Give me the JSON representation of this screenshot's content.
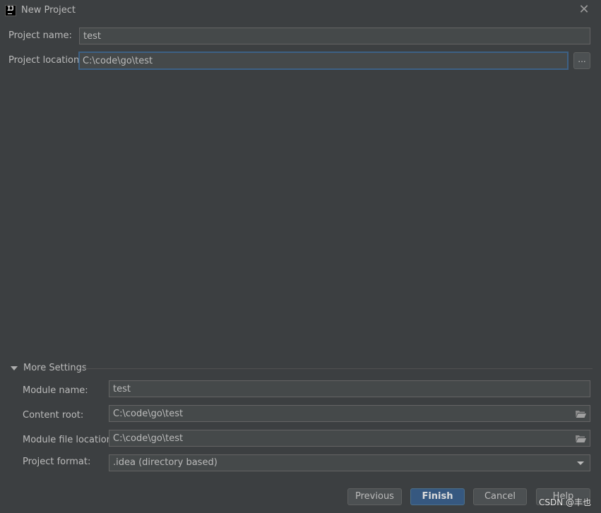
{
  "window": {
    "title": "New Project",
    "close_icon": "close-icon",
    "logo_text": "IJ"
  },
  "project": {
    "name_label": "Project name:",
    "name_value": "test",
    "location_label": "Project location:",
    "location_value": "C:\\code\\go\\test",
    "browse_label": "..."
  },
  "more_settings": {
    "title": "More Settings",
    "module_name_label": "Module name:",
    "module_name_value": "test",
    "content_root_label": "Content root:",
    "content_root_value": "C:\\code\\go\\test",
    "module_file_label": "Module file location:",
    "module_file_value": "C:\\code\\go\\test",
    "format_label": "Project format:",
    "format_value": ".idea (directory based)"
  },
  "buttons": {
    "previous": "Previous",
    "finish": "Finish",
    "cancel": "Cancel",
    "help": "Help"
  },
  "watermark": "CSDN @丰也",
  "colors": {
    "background": "#3c3f41",
    "field_bg": "#45494a",
    "focus_border": "#3d6185",
    "primary_button": "#365880"
  }
}
